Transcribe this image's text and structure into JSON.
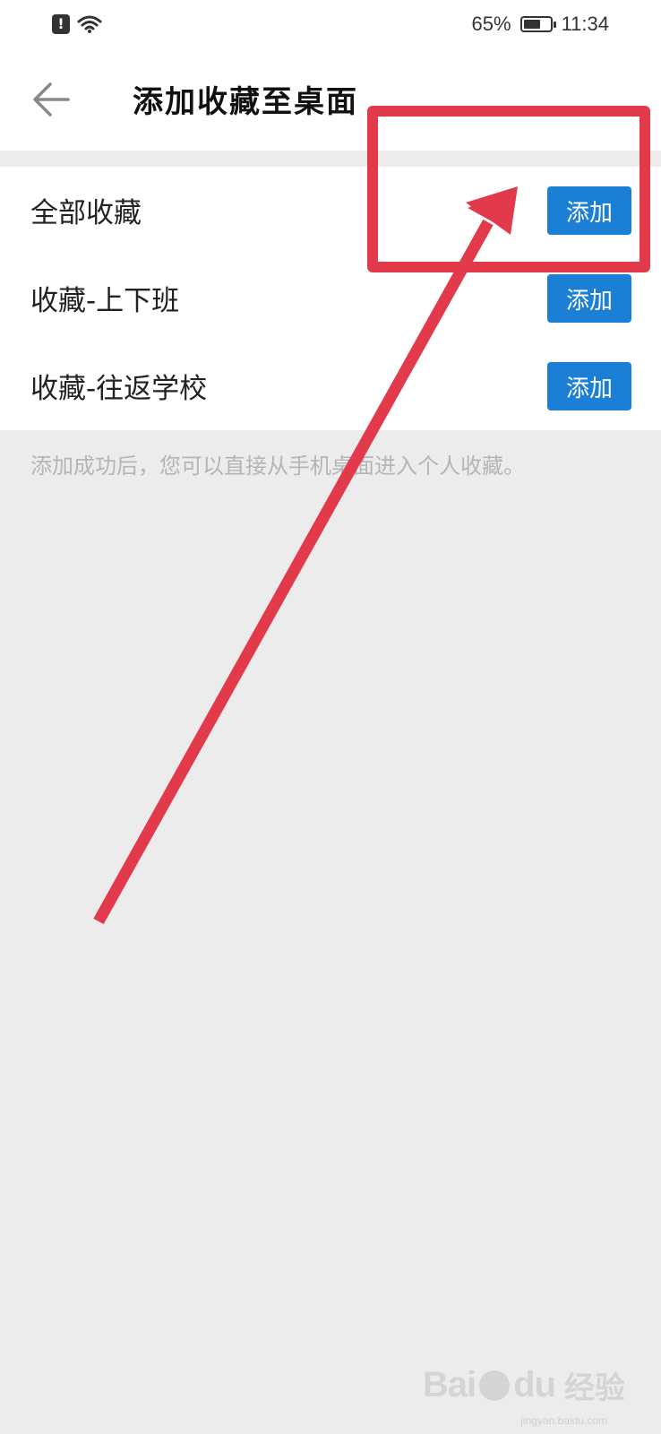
{
  "status_bar": {
    "battery_percent": "65%",
    "battery_level": 0.65,
    "time": "11:34",
    "alert_icon_glyph": "!"
  },
  "header": {
    "title": "添加收藏至桌面"
  },
  "list": {
    "items": [
      {
        "label": "全部收藏",
        "button_label": "添加"
      },
      {
        "label": "收藏-上下班",
        "button_label": "添加"
      },
      {
        "label": "收藏-往返学校",
        "button_label": "添加"
      }
    ]
  },
  "hint": "添加成功后，您可以直接从手机桌面进入个人收藏。",
  "annotation": {
    "color": "#e33a4b"
  },
  "watermark": {
    "logo": "Bai",
    "logo_suffix": "du",
    "text": "经验",
    "url": "jingyan.baidu.com"
  },
  "colors": {
    "accent": "#1b7fd6",
    "background": "#ececec"
  }
}
